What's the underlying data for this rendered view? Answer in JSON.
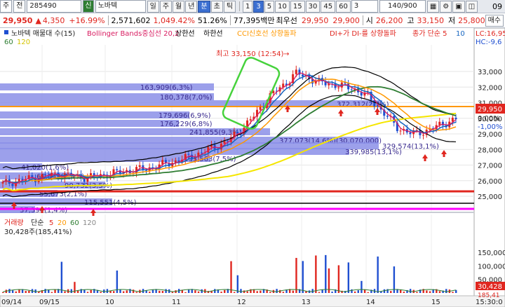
{
  "toolbar1": {
    "tab_label": "주",
    "field_label": "전",
    "code": "285490",
    "stock_badge": "신",
    "stock_name": "노바텍",
    "periods": [
      "일",
      "주",
      "월",
      "년",
      "분",
      "초",
      "틱"
    ],
    "selected_period": "분",
    "intervals": [
      "1",
      "3",
      "5",
      "10",
      "15",
      "30",
      "45",
      "60"
    ],
    "selected_interval": "3",
    "count_value": "3",
    "zoom": "140/900",
    "right_text": "09"
  },
  "toolbar2": {
    "price": "29,950",
    "change_arrow": "▲",
    "change": "4,350",
    "change_pct": "+16.99%",
    "volume": "2,571,602",
    "volume_pct": "1,049.42%",
    "ratio": "51.26%",
    "amount": "77,395백만",
    "best_label": "최우선",
    "ask": "29,950",
    "bid": "29,900",
    "open_label": "시",
    "open": "26,200",
    "high_label": "고",
    "high": "33,150",
    "low_label": "저",
    "low": "25,800",
    "order_button": "매수"
  },
  "legend": {
    "stock": "노바텍 매물대 수(15)",
    "bollinger": "Bollinger Bands중심선 20,2",
    "bb_upper": "상한선",
    "bb_lower": "하한선",
    "cci": "CCI신호선 상향돌파",
    "dmi": "DI+가 DI-를 상향돌파",
    "ma": "종가 단순 5",
    "ma_rest": "10",
    "ma60": "60",
    "ma120": "120",
    "right_lc": "LC:16,95",
    "right_hc": "HC:-9,6"
  },
  "volume_profile": [
    {
      "label": "163,909(6,3%)"
    },
    {
      "label": "180,378(7,0%)"
    },
    {
      "label": "372,312(2,7%)"
    },
    {
      "label": "179,696(6,9%)"
    },
    {
      "label": "176,229(6,8%)"
    },
    {
      "label": "241,855(9,3%)"
    },
    {
      "label": "377,073(14,6%)(30,070,000)"
    },
    {
      "label": "329,574(13,1%)"
    },
    {
      "label": "339,985(13,1%)"
    },
    {
      "label": "193,563(7,5%)"
    },
    {
      "label": "41,020(1,6%)"
    },
    {
      "label": "61,549(2,4%)"
    },
    {
      "label": "90,732(3,5%)"
    },
    {
      "label": "55,673(2,1%)"
    },
    {
      "label": "115,551(4,5%)"
    },
    {
      "label": "37,394(1,4%)"
    }
  ],
  "annotations": {
    "high_label": "최고 33,150 (12:54)",
    "high_arrow": "→"
  },
  "price_axis": {
    "ticks": [
      "33,000",
      "32,000",
      "31,000",
      "30,000",
      "29,000",
      "28,000",
      "27,000",
      "26,000",
      "25,000"
    ],
    "current_price": "29,950",
    "current_pct": "0,00%",
    "pct_label": "-1,00%"
  },
  "volume_panel": {
    "title": "거래량",
    "ma_label": "단순",
    "ma_values": [
      "5",
      "20",
      "60",
      "120"
    ],
    "value_label": "30,428주(185,41%)",
    "ticks": [
      "150,000",
      "100,000",
      "50,000"
    ],
    "current_volume": "30,428",
    "current_pct": "185,41"
  },
  "time_axis": {
    "labels": [
      "09/14",
      "09/15",
      "10",
      "11",
      "12",
      "13",
      "14",
      "15"
    ],
    "right_label": "15:30:0"
  },
  "colors": {
    "up": "#e0261f",
    "down": "#1f4fd1",
    "band_bar": "#8b8fe8",
    "ma5": "#d81b60",
    "ma10": "#1565c0",
    "ma20": "#ff9800",
    "ma60": "#2e7d32",
    "ma120": "#f5e600",
    "bb": "#000000",
    "horizontal_red": "#e0261f",
    "horizontal_magenta": "#ff00ff",
    "horizontal_orange": "#ff9800",
    "highlight_box": "#46d23c"
  },
  "icons": [
    "up-arrow-icon",
    "chart-tool-icon",
    "scroll-icon"
  ]
}
